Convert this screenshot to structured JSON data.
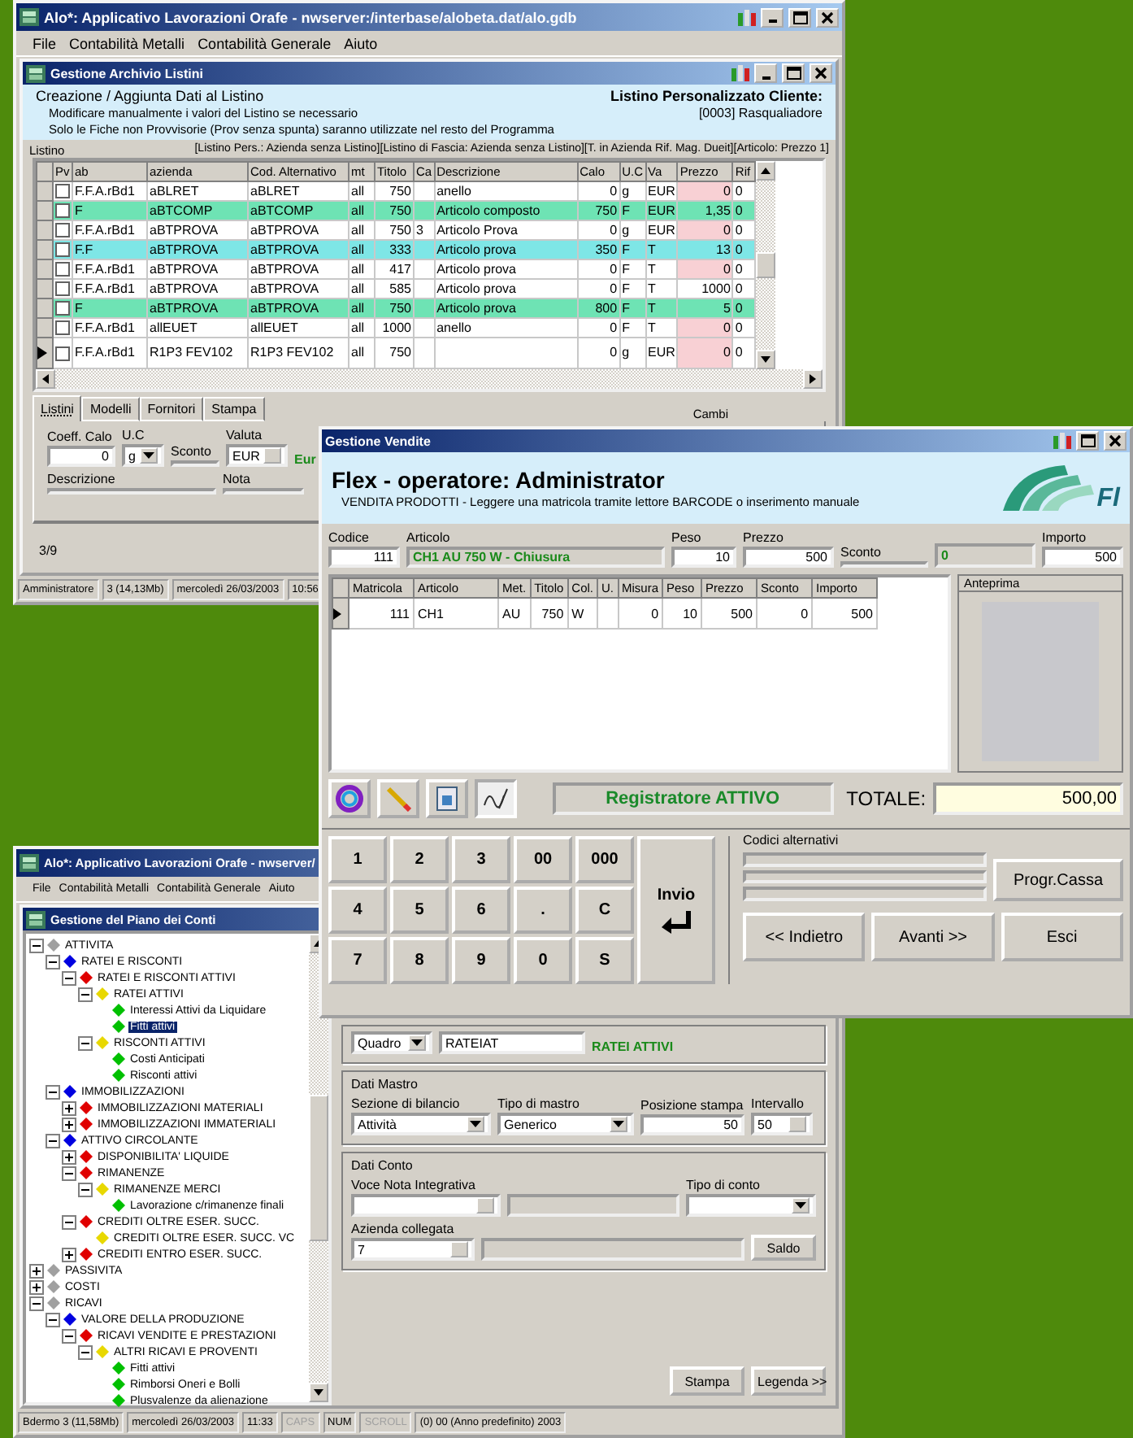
{
  "price_list_window": {
    "title": "Alo*: Applicativo Lavorazioni Orafe - nwserver:/interbase/alobeta.dat/alo.gdb",
    "menu": [
      "File",
      "Contabilità Metalli",
      "Contabilità Generale",
      "Aiuto"
    ],
    "child_title": "Gestione Archivio Listini",
    "heading": "Creazione / Aggiunta Dati al Listino",
    "notes": [
      "Modificare manualmente i valori del Listino se necessario",
      "Solo le Fiche non Provvisorie (Prov senza spunta) saranno utilizzate nel resto del Programma"
    ],
    "client_label": "Listino Personalizzato Cliente:",
    "client_value": "[0003] Rasqualiadore",
    "group_label": "Listino",
    "group_info": "[Listino Pers.: Azienda senza Listino][Listino di Fascia: Azienda senza Listino][T. in Azienda Rif. Mag. Dueit][Articolo: Prezzo 1]",
    "table": {
      "columns": [
        "Pv",
        "ab",
        "azienda",
        "Cod. Alternativo",
        "mt",
        "Titolo",
        "Ca",
        "Descrizione",
        "Calo",
        "U.C",
        "Va",
        "Prezzo",
        "Rif"
      ],
      "rows": [
        {
          "checked": false,
          "selected": false,
          "color": "#ffffff",
          "price_flagged": true,
          "cells": [
            "",
            "F.F.A.rBd1",
            "aBLRET",
            "aBLRET",
            "all",
            "750",
            null,
            "anello",
            "0",
            "g",
            "EUR",
            "0",
            "0"
          ]
        },
        {
          "checked": false,
          "selected": false,
          "color": "#6ee3b4",
          "price_flagged": false,
          "cells": [
            "",
            "F",
            "aBTCOMP",
            "aBTCOMP",
            "all",
            "750",
            null,
            "Articolo composto",
            "750",
            "F",
            "EUR",
            "1,35",
            "0"
          ]
        },
        {
          "checked": false,
          "selected": false,
          "color": "#ffffff",
          "price_flagged": true,
          "cells": [
            "",
            "F.F.A.rBd1",
            "aBTPROVA",
            "aBTPROVA",
            "all",
            "750",
            "3",
            "Articolo Prova",
            "0",
            "g",
            "EUR",
            "0",
            "0"
          ]
        },
        {
          "checked": false,
          "selected": false,
          "color": "#7ee6e6",
          "price_flagged": false,
          "cells": [
            "",
            "F.F",
            "aBTPROVA",
            "aBTPROVA",
            "all",
            "333",
            null,
            "Articolo prova",
            "350",
            "F",
            "T",
            "13",
            "0"
          ]
        },
        {
          "checked": false,
          "selected": false,
          "color": "#ffffff",
          "price_flagged": true,
          "cells": [
            "",
            "F.F.A.rBd1",
            "aBTPROVA",
            "aBTPROVA",
            "all",
            "417",
            null,
            "Articolo prova",
            "0",
            "F",
            "T",
            "0",
            "0"
          ]
        },
        {
          "checked": false,
          "selected": false,
          "color": "#ffffff",
          "price_flagged": false,
          "cells": [
            "",
            "F.F.A.rBd1",
            "aBTPROVA",
            "aBTPROVA",
            "all",
            "585",
            null,
            "Articolo prova",
            "0",
            "F",
            "T",
            "1000",
            "0"
          ]
        },
        {
          "checked": false,
          "selected": false,
          "color": "#6ee3b4",
          "price_flagged": false,
          "cells": [
            "",
            "F",
            "aBTPROVA",
            "aBTPROVA",
            "all",
            "750",
            null,
            "Articolo prova",
            "800",
            "F",
            "T",
            "5",
            "0"
          ]
        },
        {
          "checked": false,
          "selected": false,
          "color": "#ffffff",
          "price_flagged": true,
          "cells": [
            "",
            "F.F.A.rBd1",
            "allEUET",
            "allEUET",
            "all",
            "1000",
            null,
            "anello",
            "0",
            "F",
            "T",
            "0",
            "0"
          ]
        },
        {
          "checked": false,
          "selected": true,
          "color": "#ffffff",
          "price_flagged": true,
          "cells": [
            "",
            "F.F.A.rBd1",
            "R1P3 FEV102",
            "R1P3 FEV102",
            "all",
            "750",
            null,
            null,
            "0",
            "g",
            "EUR",
            "0",
            "0"
          ]
        }
      ]
    },
    "tabs": [
      {
        "label": "Listini",
        "selected": true
      },
      {
        "label": "Modelli",
        "selected": false
      },
      {
        "label": "Fornitori",
        "selected": false
      },
      {
        "label": "Stampa",
        "selected": false
      }
    ],
    "exchange_label": "Cambi",
    "coeff_label": "Coeff. Calo",
    "coeff_value": "0",
    "uc_label": "U.C",
    "uc_value": "g",
    "sconto_label": "Sconto",
    "valuta_label": "Valuta",
    "valuta_value": "EUR",
    "valuta_name": "Eur",
    "descrizione_label": "Descrizione",
    "nota_label": "Nota",
    "record_counter": "3/9",
    "status_bar": [
      "Amministratore",
      "3 (14,13Mb)",
      "mercoledì 26/03/2003",
      "10:56"
    ]
  },
  "sales_window": {
    "title": "Gestione Vendite",
    "heading": "Flex - operatore: Administrator",
    "subheading": "VENDITA PRODOTTI - Leggere una matricola tramite lettore BARCODE o inserimento manuale",
    "logo_text": "Fl",
    "codice": {
      "label": "Codice",
      "value": "111"
    },
    "articolo": {
      "label": "Articolo",
      "value": "CH1 AU 750 W - Chiusura"
    },
    "peso": {
      "label": "Peso",
      "value": "10"
    },
    "prezzo": {
      "label": "Prezzo",
      "value": "500"
    },
    "sconto": {
      "label": "Sconto"
    },
    "flag_value": "0",
    "importo": {
      "label": "Importo",
      "value": "500"
    },
    "table": {
      "columns": [
        "Matricola",
        "Articolo",
        "Met.",
        "Titolo",
        "Col.",
        "U.",
        "Misura",
        "Peso",
        "Prezzo",
        "Sconto",
        "Importo"
      ],
      "rows": [
        {
          "selected": true,
          "cells": [
            "111",
            "CH1",
            "AU",
            "750",
            "W",
            null,
            "0",
            "10",
            "500",
            "0",
            "500"
          ]
        }
      ]
    },
    "preview_label": "Anteprima",
    "register_status": "Registratore ATTIVO",
    "total_label": "TOTALE:",
    "total_value": "500,00",
    "keypad": [
      "1",
      "2",
      "3",
      "00",
      "000",
      "4",
      "5",
      "6",
      ".",
      "C",
      "7",
      "8",
      "9",
      "0",
      "S"
    ],
    "enter_key": "Invio",
    "alt_codes_label": "Codici alternativi",
    "progr_button": "Progr.Cassa",
    "back_button": "<< Indietro",
    "next_button": "Avanti >>",
    "exit_button": "Esci"
  },
  "accounts_window": {
    "title": "Alo*: Applicativo Lavorazioni Orafe - nwserver/",
    "menu": [
      "File",
      "Contabilità Metalli",
      "Contabilità Generale",
      "Aiuto"
    ],
    "child_title": "Gestione del Piano dei Conti",
    "tree": [
      {
        "label": "ATTIVITA",
        "color": "#a0a0a0",
        "expanded": true,
        "selected": false,
        "children": [
          {
            "label": "RATEI E RISCONTI",
            "color": "#0000e0",
            "expanded": true,
            "selected": false,
            "children": [
              {
                "label": "RATEI E RISCONTI ATTIVI",
                "color": "#e00000",
                "expanded": true,
                "selected": false,
                "children": [
                  {
                    "label": "RATEI ATTIVI",
                    "color": "#e8d800",
                    "expanded": true,
                    "selected": false,
                    "children": [
                      {
                        "label": "Interessi Attivi da Liquidare",
                        "color": "#00c000",
                        "selected": false
                      },
                      {
                        "label": "Fitti attivi",
                        "color": "#00c000",
                        "selected": true
                      }
                    ]
                  },
                  {
                    "label": "RISCONTI ATTIVI",
                    "color": "#e8d800",
                    "expanded": true,
                    "selected": false,
                    "children": [
                      {
                        "label": "Costi Anticipati",
                        "color": "#00c000",
                        "selected": false
                      },
                      {
                        "label": "Risconti attivi",
                        "color": "#00c000",
                        "selected": false
                      }
                    ]
                  }
                ]
              }
            ]
          },
          {
            "label": "IMMOBILIZZAZIONI",
            "color": "#0000e0",
            "expanded": true,
            "selected": false,
            "children": [
              {
                "label": "IMMOBILIZZAZIONI MATERIALI",
                "color": "#e00000",
                "expanded": false,
                "selected": false
              },
              {
                "label": "IMMOBILIZZAZIONI IMMATERIALI",
                "color": "#e00000",
                "expanded": false,
                "selected": false
              }
            ]
          },
          {
            "label": "ATTIVO CIRCOLANTE",
            "color": "#0000e0",
            "expanded": true,
            "selected": false,
            "children": [
              {
                "label": "DISPONIBILITA' LIQUIDE",
                "color": "#e00000",
                "expanded": false,
                "selected": false
              },
              {
                "label": "RIMANENZE",
                "color": "#e00000",
                "expanded": true,
                "selected": false,
                "children": [
                  {
                    "label": "RIMANENZE MERCI",
                    "color": "#e8d800",
                    "expanded": true,
                    "selected": false,
                    "children": [
                      {
                        "label": "Lavorazione c/rimanenze finali",
                        "color": "#00c000",
                        "selected": false
                      }
                    ]
                  }
                ]
              },
              {
                "label": "CREDITI OLTRE ESER. SUCC.",
                "color": "#e00000",
                "expanded": true,
                "selected": false,
                "children": [
                  {
                    "label": "CREDITI OLTRE ESER. SUCC. VC",
                    "color": "#e8d800",
                    "selected": false
                  }
                ]
              },
              {
                "label": "CREDITI ENTRO ESER. SUCC.",
                "color": "#e00000",
                "expanded": false,
                "selected": false
              }
            ]
          }
        ]
      },
      {
        "label": "PASSIVITA",
        "color": "#a0a0a0",
        "expanded": false,
        "selected": false
      },
      {
        "label": "COSTI",
        "color": "#a0a0a0",
        "expanded": false,
        "selected": false
      },
      {
        "label": "RICAVI",
        "color": "#a0a0a0",
        "expanded": true,
        "selected": false,
        "children": [
          {
            "label": "VALORE DELLA PRODUZIONE",
            "color": "#0000e0",
            "expanded": true,
            "selected": false,
            "children": [
              {
                "label": "RICAVI VENDITE E PRESTAZIONI",
                "color": "#e00000",
                "expanded": true,
                "selected": false,
                "children": [
                  {
                    "label": "ALTRI RICAVI E PROVENTI",
                    "color": "#e8d800",
                    "expanded": true,
                    "selected": false,
                    "children": [
                      {
                        "label": "Fitti attivi",
                        "color": "#00c000",
                        "selected": false
                      },
                      {
                        "label": "Rimborsi Oneri e Bolli",
                        "color": "#00c000",
                        "selected": false
                      },
                      {
                        "label": "Plusvalenze da alienazione",
                        "color": "#00c000",
                        "selected": false
                      }
                    ]
                  }
                ]
              }
            ]
          }
        ]
      }
    ],
    "form": {
      "quadro": "Quadro",
      "codice": "RATEIAT",
      "codice_nome": "RATEI ATTIVI",
      "mastro_title": "Dati Mastro",
      "sezione_label": "Sezione di bilancio",
      "sezione_value": "Attività",
      "tipo_mastro_label": "Tipo di mastro",
      "tipo_mastro_value": "Generico",
      "posizione_label": "Posizione stampa",
      "posizione_value": "50",
      "intervallo_label": "Intervallo",
      "intervallo_value": "50",
      "conto_title": "Dati Conto",
      "voce_label": "Voce Nota Integrativa",
      "tipo_conto_label": "Tipo di conto",
      "azienda_label": "Azienda collegata",
      "azienda_value": "7",
      "saldo_button": "Saldo",
      "stampa_button": "Stampa",
      "legenda_button": "Legenda >>"
    },
    "status_bar": [
      {
        "text": "Bdermo 3 (11,58Mb)",
        "on": true
      },
      {
        "text": "mercoledì 26/03/2003",
        "on": true
      },
      {
        "text": "11:33",
        "on": true
      },
      {
        "text": "CAPS",
        "on": false
      },
      {
        "text": "NUM",
        "on": true
      },
      {
        "text": "SCROLL",
        "on": false
      },
      {
        "text": "(0) 00 (Anno predefinito) 2003",
        "on": true
      }
    ]
  }
}
